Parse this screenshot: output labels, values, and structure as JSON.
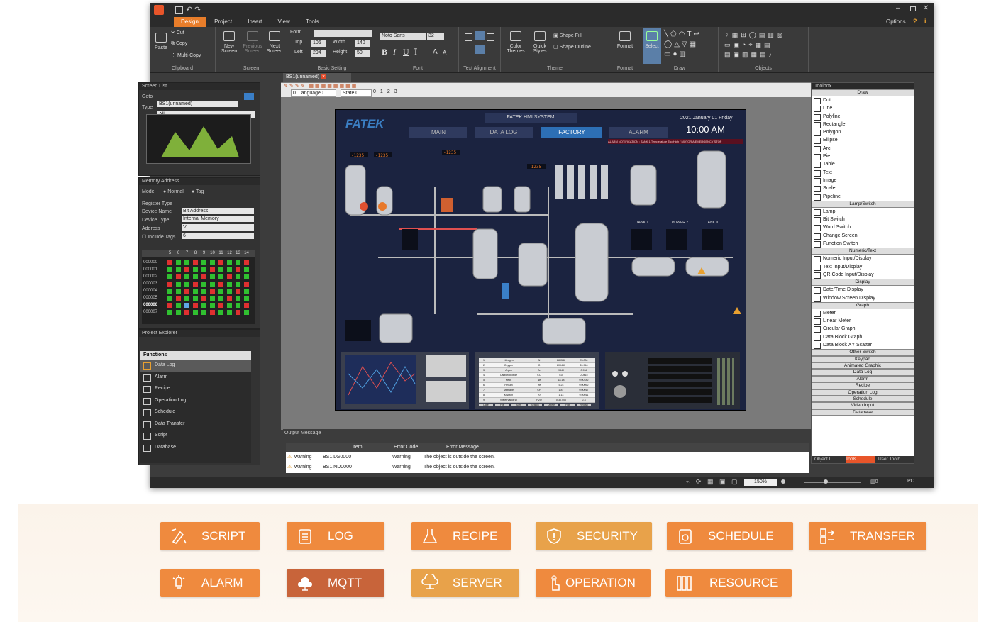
{
  "window": {
    "menu": [
      "Design",
      "Project",
      "Insert",
      "View",
      "Tools"
    ],
    "options_label": "Options"
  },
  "ribbon": {
    "clipboard": {
      "cut": "Cut",
      "copy": "Copy",
      "paste": "Paste",
      "multi_copy": "Multi-Copy",
      "label": "Clipboard"
    },
    "screen": {
      "new": "New Screen",
      "previous": "Previous Screen",
      "next": "Next Screen",
      "label": "Screen"
    },
    "basic": {
      "form": "Form",
      "top": "Top",
      "top_val": "106",
      "left": "Left",
      "left_val": "294",
      "width": "Width",
      "width_val": "140",
      "height": "Height",
      "height_val": "50",
      "label": "Basic Setting"
    },
    "font": {
      "name": "Noto Sans",
      "size": "32",
      "label": "Font"
    },
    "text_alignment": {
      "label": "Text Alignment"
    },
    "theme": {
      "color": "Color Themes",
      "quick": "Quick Styles",
      "fill": "Shape Fill",
      "outline": "Shape Outline",
      "label": "Theme"
    },
    "format": {
      "btn": "Format",
      "label": "Format"
    },
    "draw": {
      "select": "Select",
      "label": "Draw"
    },
    "objects": {
      "label": "Objects"
    }
  },
  "doc": {
    "tab": "BS1(unnamed)",
    "language": "0. Language0",
    "state": "State 0",
    "pages": [
      "0",
      "1",
      "2",
      "3"
    ]
  },
  "screen_list": {
    "title": "Screen List",
    "goto": "Goto",
    "goto_val": "BS1(unnamed)",
    "type": "Type",
    "type_val": "All"
  },
  "memory": {
    "title": "Memory Address",
    "mode": "Mode",
    "normal": "Normal",
    "tag": "Tag",
    "register_type": "Register Type",
    "register_val": "Bit Address",
    "device_name": "Device Name",
    "device_val": "Internal Memory",
    "device_type": "Device Type",
    "device_type_val": "V",
    "address": "Address",
    "address_val": "6",
    "include_tags": "Include Tags",
    "cols": [
      "5",
      "6",
      "7",
      "8",
      "9",
      "10",
      "11",
      "12",
      "13",
      "14"
    ],
    "rows": [
      "000000",
      "000001",
      "000002",
      "000003",
      "000004",
      "000005",
      "000006",
      "000007"
    ]
  },
  "explorer": {
    "title": "Project Explorer",
    "functions": "Functions",
    "items": [
      "Data Log",
      "Alarm",
      "Recipe",
      "Operation Log",
      "Schedule",
      "Data Transfer",
      "Script",
      "Database"
    ]
  },
  "hmi": {
    "brand": "FATEK",
    "system": "FATEK HMI SYSTEM",
    "date": "2021 January 01 Friday",
    "time": "10:00 AM",
    "tabs": [
      "MAIN",
      "DATA LOG",
      "FACTORY",
      "ALARM"
    ],
    "active_tab": "FACTORY",
    "alarm_note": "ALARM NOTIFICATION : TANK 1 Temperature Too High / MOTOR A EMERGENCY STOP",
    "tanks": [
      "TANK 1",
      "POWER 2",
      "TANK II"
    ],
    "table_rows": [
      [
        "1",
        "Nitrogen",
        "N",
        "280546",
        "78.084"
      ],
      [
        "2",
        "Oxygen",
        "O",
        "209460",
        "20.946"
      ],
      [
        "3",
        "Argon",
        "Ar",
        "9340",
        "0.934"
      ],
      [
        "4",
        "Carbon dioxide",
        "CO",
        "415",
        "0.0415"
      ],
      [
        "5",
        "Neon",
        "Ne",
        "18.18",
        "0.00182"
      ],
      [
        "6",
        "Helium",
        "He",
        "5.24",
        "0.00052"
      ],
      [
        "7",
        "Methane",
        "CH",
        "1.87",
        "0.00017"
      ],
      [
        "8",
        "Krypton",
        "Kr",
        "1.14",
        "0.00011"
      ],
      [
        "9",
        "Water vapor(1)",
        "H2O",
        "0-30,000",
        "0-3"
      ]
    ],
    "table_buttons": [
      "Date",
      "File",
      "Sort",
      "Search",
      "Delete",
      "Flat",
      "Reload"
    ]
  },
  "output": {
    "title": "Output Message",
    "headers": [
      "Item",
      "Error Code",
      "Error Message"
    ],
    "rows": [
      {
        "level": "warning",
        "item": "BS1.LG0000",
        "code": "Warning",
        "msg": "The object is outside the screen."
      },
      {
        "level": "warning",
        "item": "BS1.ND0000",
        "code": "Warning",
        "msg": "The object is outside the screen."
      }
    ]
  },
  "toolbox": {
    "title": "Toolbox",
    "sections": [
      {
        "name": "Draw",
        "items": [
          "Dot",
          "Line",
          "Polyline",
          "Rectangle",
          "Polygon",
          "Ellipse",
          "Arc",
          "Pie",
          "Table",
          "Text",
          "Image",
          "Scale",
          "Pipeline"
        ]
      },
      {
        "name": "Lamp/Switch",
        "items": [
          "Lamp",
          "Bit Switch",
          "Word Switch",
          "Change Screen",
          "Function Switch"
        ]
      },
      {
        "name": "Numeric/Text",
        "items": [
          "Numeric Input/Display",
          "Text Input/Display",
          "QR Code Input/Display"
        ]
      },
      {
        "name": "Display",
        "items": [
          "Date/Time Display",
          "Window Screen Display"
        ]
      },
      {
        "name": "Graph",
        "items": [
          "Meter",
          "Linear Meter",
          "Circular Graph",
          "Data Block Graph",
          "Data Block XY Scatter"
        ]
      }
    ],
    "collapsed": [
      "Other Switch",
      "Keypad",
      "Animated Graphic",
      "Data Log",
      "Alarm",
      "Recipe",
      "Operation Log",
      "Schedule",
      "Video Input",
      "Database"
    ],
    "tabs": [
      "Object L...",
      "Tools...",
      "User Toolb..."
    ]
  },
  "status": {
    "zoom": "150%",
    "mode": "PC",
    "count": "0"
  },
  "features": [
    "SCRIPT",
    "LOG",
    "RECIPE",
    "SECURITY",
    "SCHEDULE",
    "TRANSFER",
    "ALARM",
    "MQTT",
    "SERVER",
    "OPERATION",
    "RESOURCE"
  ]
}
